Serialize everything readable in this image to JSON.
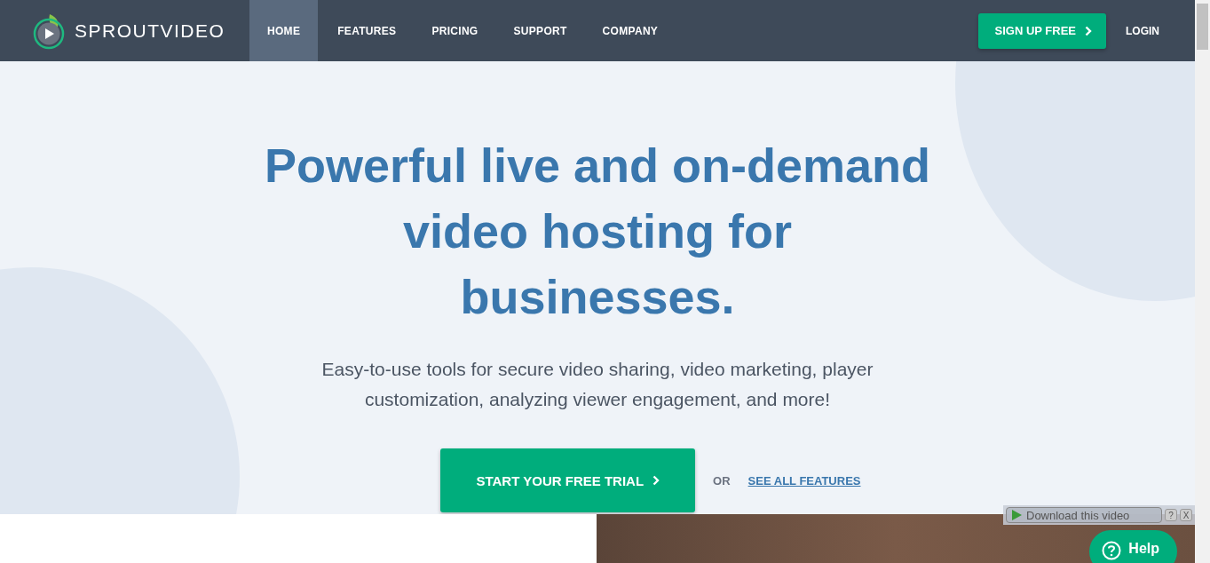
{
  "logo": {
    "text": "SPROUTVIDEO"
  },
  "nav": [
    {
      "label": "HOME",
      "selected": true
    },
    {
      "label": "FEATURES",
      "selected": false
    },
    {
      "label": "PRICING",
      "selected": false
    },
    {
      "label": "SUPPORT",
      "selected": false
    },
    {
      "label": "COMPANY",
      "selected": false
    }
  ],
  "signup_button": {
    "label": "SIGN UP FREE"
  },
  "login_link": {
    "label": "LOGIN"
  },
  "hero": {
    "headline": "Powerful live and on-demand video hosting for businesses.",
    "subtitle": "Easy-to-use tools for secure video sharing, video marketing, player customization, analyzing viewer engagement, and more!",
    "cta": "START YOUR FREE TRIAL",
    "or": "OR",
    "features_link": "SEE ALL FEATURES"
  },
  "download_bar": {
    "label": "Download this video",
    "help": "?",
    "close": "X"
  },
  "help_button": {
    "label": "Help"
  }
}
